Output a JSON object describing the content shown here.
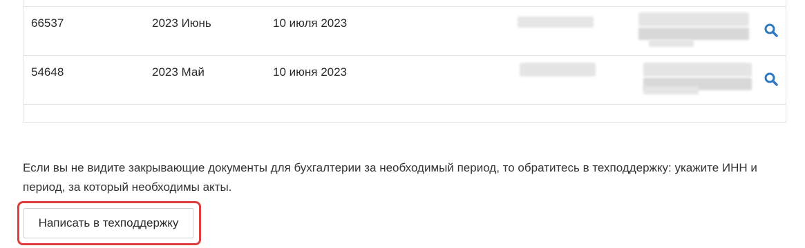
{
  "table": {
    "rows": [
      {
        "id": "66537",
        "period": "2023 Июнь",
        "date": "10 июля 2023",
        "search_icon": "search-icon"
      },
      {
        "id": "54648",
        "period": "2023 Май",
        "date": "10 июня 2023",
        "search_icon": "search-icon"
      }
    ]
  },
  "note": {
    "text": "Если вы не видите закрывающие документы для бухгалтерии за необходимый период, то обратитесь в техподдержку: укажите ИНН и период, за который необходимы акты."
  },
  "support_button": {
    "label": "Написать в техподдержку",
    "highlight_color": "#e03c3c"
  },
  "colors": {
    "icon": "#2f79c1",
    "border": "#e3e3e3"
  }
}
